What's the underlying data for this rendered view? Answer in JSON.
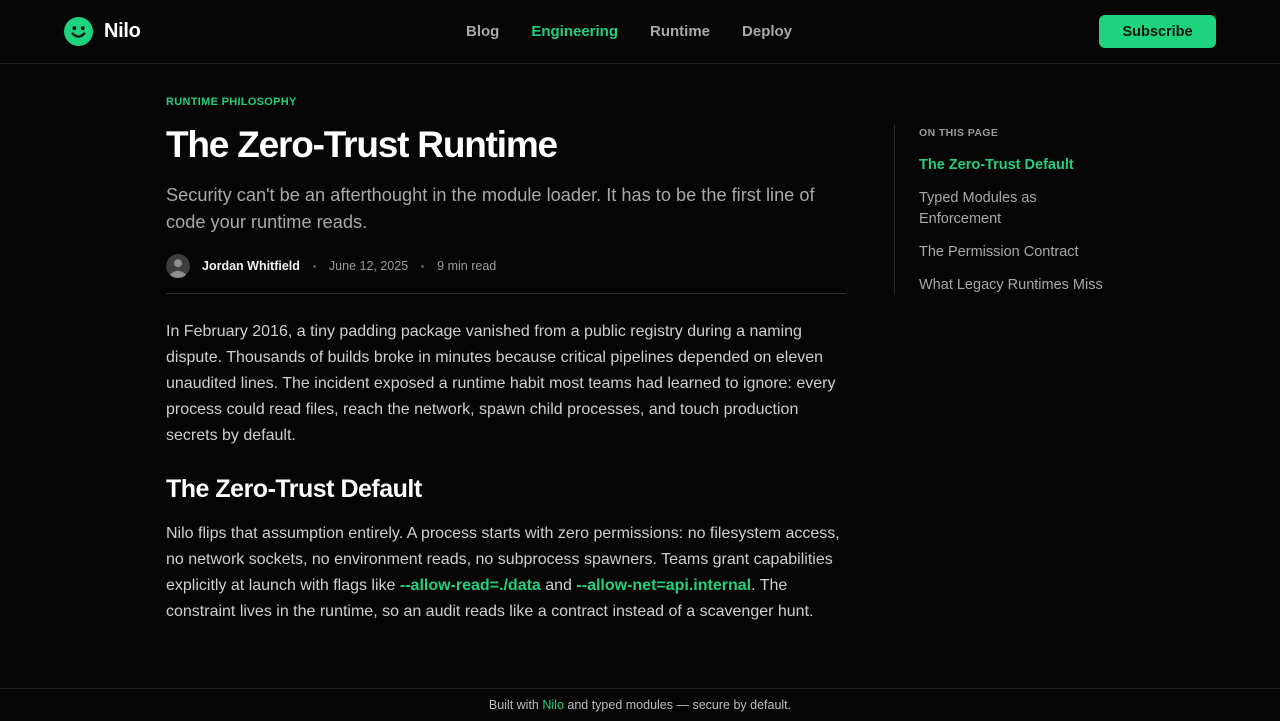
{
  "header": {
    "brand": "Nilo",
    "nav": [
      "Blog",
      "Engineering",
      "Runtime",
      "Deploy"
    ],
    "active_nav": "Engineering",
    "subscribe_label": "Subscribe"
  },
  "article": {
    "kicker": "RUNTIME PHILOSOPHY",
    "title": "The Zero-Trust Runtime",
    "dek": "Security can't be an afterthought in the module loader. It has to be the first line of code your runtime reads.",
    "author": "Jordan Whitfield",
    "date": "June 12, 2025",
    "read_time": "9 min read",
    "intro": "In February 2016, a tiny padding package vanished from a public registry during a naming dispute. Thousands of builds broke in minutes because critical pipelines depended on eleven unaudited lines. The incident exposed a runtime habit most teams had learned to ignore: every process could read files, reach the network, spawn child processes, and touch production secrets by default.",
    "section_heading": "The Zero-Trust Default",
    "section_text_1": "Nilo flips that assumption entirely. A process starts with zero permissions: no filesystem access, no network sockets, no environment reads, no subprocess spawners. Teams grant capabilities explicitly at launch with flags like ",
    "flag_read": "--allow-read=./data",
    "section_text_2": " and ",
    "flag_net": "--allow-net=api.internal",
    "section_text_3": ". The constraint lives in the runtime, so an audit reads like a contract instead of a scavenger hunt."
  },
  "toc": {
    "heading": "ON THIS PAGE",
    "items": [
      "The Zero-Trust Default",
      "Typed Modules as Enforcement",
      "The Permission Contract",
      "What Legacy Runtimes Miss"
    ],
    "active_item": "The Zero-Trust Default"
  },
  "footer": {
    "prefix": "Built with ",
    "link": "Nilo",
    "suffix": " and typed modules — secure by default."
  },
  "colors": {
    "accent": "#22d07c",
    "background": "#050505"
  }
}
